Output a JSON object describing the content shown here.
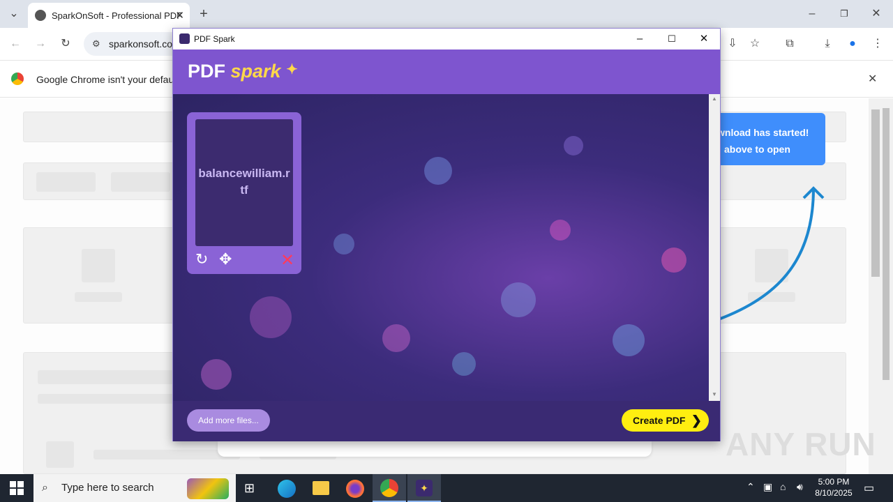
{
  "browser": {
    "tab_title": "SparkOnSoft - Professional PDF",
    "url": "sparkonsoft.co",
    "infobar_text": "Google Chrome isn't your default",
    "notice_line1": "wnload has started!",
    "notice_line2": "above to open"
  },
  "app": {
    "window_title": "PDF Spark",
    "logo_main": "PDF",
    "logo_accent": "spark",
    "file_name": "balancewilliam.rtf",
    "add_files_label": "Add more files...",
    "create_pdf_label": "Create PDF"
  },
  "taskbar": {
    "search_placeholder": "Type here to search",
    "time": "5:00 PM",
    "date": "8/10/2025"
  },
  "watermark": "ANY RUN",
  "colors": {
    "app_header": "#7e55cf",
    "footer": "#3a2a73",
    "create_button": "#ffee10",
    "add_button": "#a98be0",
    "notice": "#3f8efc"
  }
}
